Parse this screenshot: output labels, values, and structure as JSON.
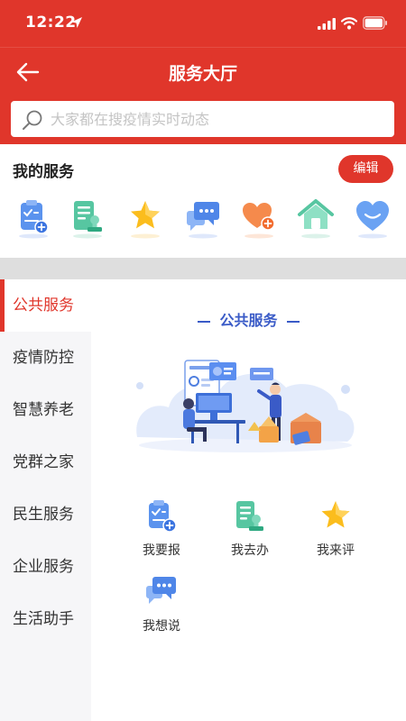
{
  "status": {
    "time": "12:22"
  },
  "navbar": {
    "title": "服务大厅"
  },
  "search": {
    "placeholder": "大家都在搜疫情实时动态"
  },
  "my_services": {
    "title": "我的服务",
    "edit_label": "编辑",
    "icons": [
      "clipboard-plus-icon",
      "stamp-document-icon",
      "star-icon",
      "chat-bubble-icon",
      "heart-plus-icon",
      "house-icon",
      "heart-icon"
    ]
  },
  "sidebar": {
    "items": [
      {
        "label": "公共服务",
        "active": true
      },
      {
        "label": "疫情防控"
      },
      {
        "label": "智慧养老"
      },
      {
        "label": "党群之家"
      },
      {
        "label": "民生服务"
      },
      {
        "label": "企业服务"
      },
      {
        "label": "生活助手"
      }
    ]
  },
  "content": {
    "section_title": "公共服务",
    "services": [
      {
        "label": "我要报",
        "icon": "clipboard-plus-icon"
      },
      {
        "label": "我去办",
        "icon": "stamp-document-icon"
      },
      {
        "label": "我来评",
        "icon": "star-icon"
      },
      {
        "label": "我想说",
        "icon": "chat-bubble-icon"
      }
    ]
  },
  "colors": {
    "primary": "#e0362b",
    "accent_blue": "#3a5bc7",
    "sidebar_bg": "#f6f6f8"
  }
}
